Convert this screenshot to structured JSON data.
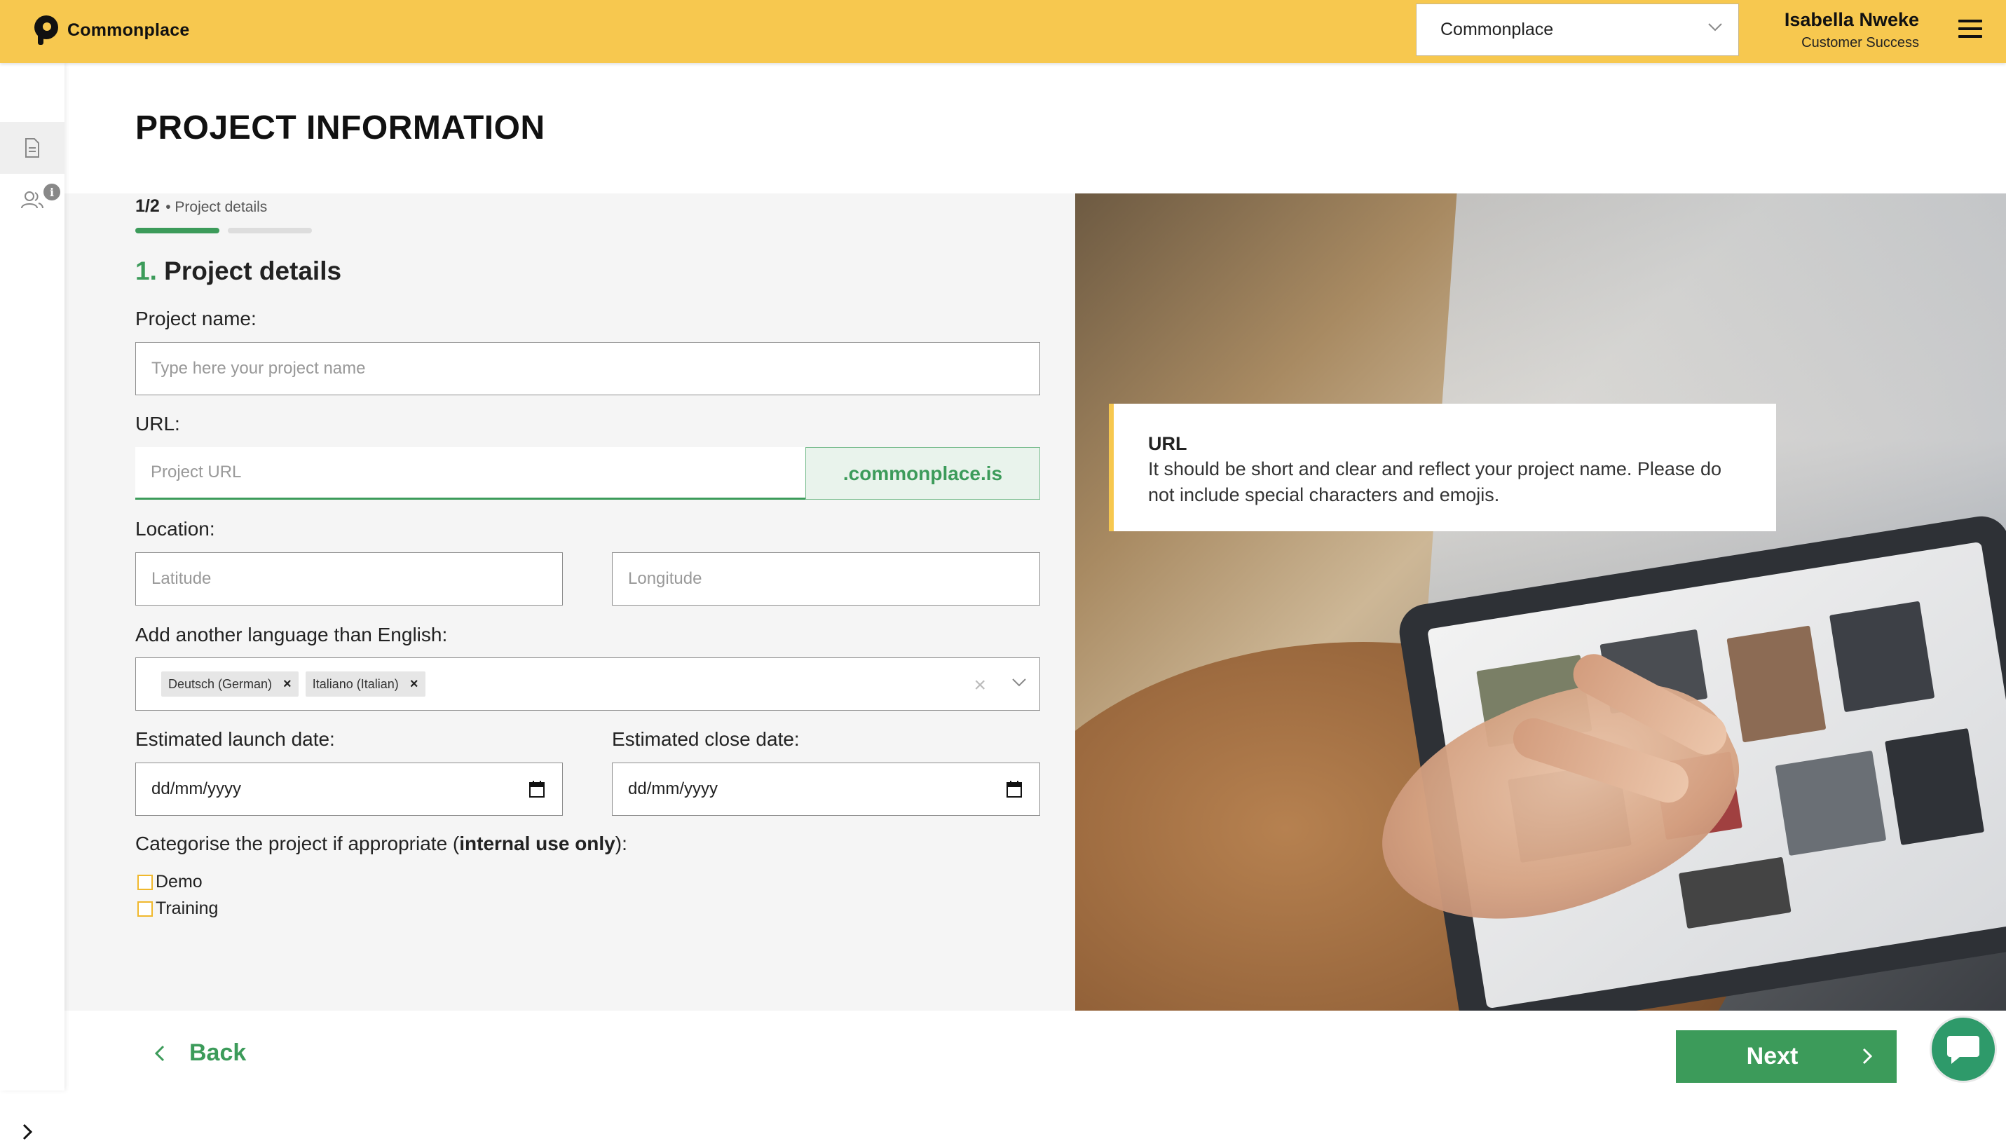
{
  "header": {
    "brand": "Commonplace",
    "org_select_value": "Commonplace",
    "user_name": "Isabella Nweke",
    "user_role": "Customer Success"
  },
  "sidebar": {
    "items": [
      {
        "icon": "document-icon",
        "active": true
      },
      {
        "icon": "users-icon",
        "badge": "i"
      }
    ]
  },
  "page": {
    "title": "PROJECT INFORMATION"
  },
  "stepper": {
    "count": "1/2",
    "label": "• Project details",
    "total_steps": 2,
    "current_step": 1
  },
  "form": {
    "section_number": "1.",
    "section_title": "Project details",
    "project_name_label": "Project name:",
    "project_name_placeholder": "Type here your project name",
    "url_label": "URL:",
    "url_placeholder": "Project URL",
    "url_suffix": ".commonplace.is",
    "location_label": "Location:",
    "latitude_placeholder": "Latitude",
    "longitude_placeholder": "Longitude",
    "language_label": "Add another language than English:",
    "languages": [
      "Deutsch (German)",
      "Italiano (Italian)"
    ],
    "launch_label": "Estimated launch date:",
    "launch_value": "dd/mm/yyyy",
    "close_label": "Estimated close date:",
    "close_value": "dd/mm/yyyy",
    "category_label_pre": "Categorise the project if appropriate (",
    "category_label_bold": "internal use only",
    "category_label_post": "):",
    "categories": [
      "Demo",
      "Training"
    ]
  },
  "info_card": {
    "title": "URL",
    "text": "It should be short and clear and reflect your project name. Please do not include special characters and emojis."
  },
  "footer": {
    "back_label": "Back",
    "next_label": "Next"
  },
  "colors": {
    "header_bg": "#f7c84f",
    "accent_green": "#3c9b5a",
    "panel_bg": "#f5f5f5"
  }
}
